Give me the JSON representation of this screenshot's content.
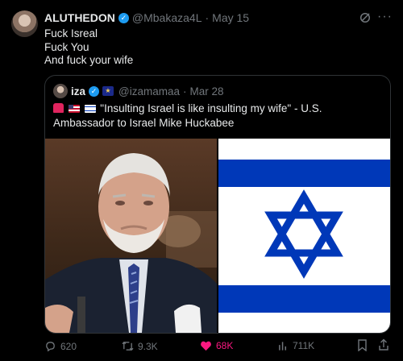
{
  "tweet": {
    "display_name": "ALUTHEDON",
    "handle": "@Mbakaza4L",
    "separator": "·",
    "date": "May 15",
    "lines": [
      "Fuck Isreal",
      "Fuck You",
      "And fuck your wife"
    ]
  },
  "quoted": {
    "display_name": "iza",
    "handle": "@izamamaa",
    "separator": "·",
    "date": "Mar 28",
    "text": "\"Insulting Israel is like insulting my wife\" - U.S. Ambassador to Israel Mike Huckabee",
    "emojis": [
      "siren-emoji",
      "us-flag-emoji",
      "israel-flag-emoji"
    ]
  },
  "actions": {
    "replies": "620",
    "reposts": "9.3K",
    "likes": "68K",
    "views": "711K"
  },
  "colors": {
    "background": "#000000",
    "text": "#e7e9ea",
    "muted": "#71767b",
    "verified": "#1d9bf0",
    "like": "#f91880",
    "israel_blue": "#0038b8"
  }
}
